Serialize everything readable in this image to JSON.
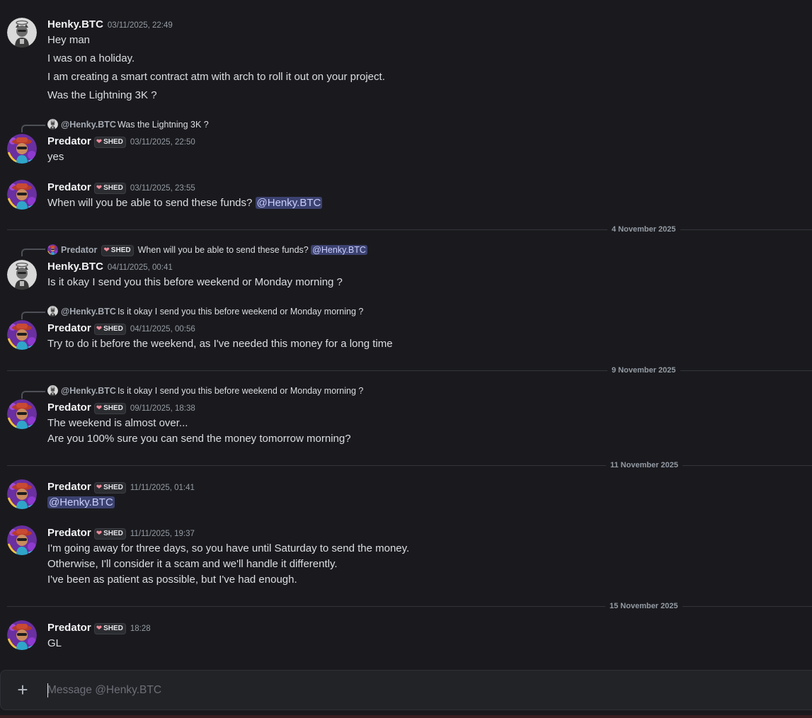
{
  "users": {
    "henky": {
      "name": "Henky.BTC"
    },
    "predator": {
      "name": "Predator",
      "tag": "SHED"
    }
  },
  "messages": [
    {
      "author": "Henky.BTC",
      "time": "03/11/2025, 22:49",
      "lines": [
        "Hey man",
        "I was on a holiday.",
        "I am creating a smart contract atm with arch to roll it out on your project.",
        "Was the Lightning 3K ?"
      ]
    },
    {
      "reply": {
        "who": "@Henky.BTC",
        "text": "Was the Lightning 3K ?"
      },
      "author": "Predator",
      "tag": "SHED",
      "time": "03/11/2025, 22:50",
      "lines": [
        "yes"
      ]
    },
    {
      "author": "Predator",
      "tag": "SHED",
      "time": "03/11/2025, 23:55",
      "text": "When will you be able to send these funds?",
      "mention": "@Henky.BTC"
    },
    {
      "reply": {
        "who": "Predator",
        "tag": "SHED",
        "text": "When will you be able to send these funds?",
        "mention": "@Henky.BTC"
      },
      "author": "Henky.BTC",
      "time": "04/11/2025, 00:41",
      "lines": [
        "Is it okay I send you this before weekend or Monday morning ?"
      ]
    },
    {
      "reply": {
        "who": "@Henky.BTC",
        "text": "Is it okay I send you this before weekend or Monday morning ?"
      },
      "author": "Predator",
      "tag": "SHED",
      "time": "04/11/2025, 00:56",
      "lines": [
        "Try to do it before the weekend, as I've needed this money for a long time"
      ]
    },
    {
      "reply": {
        "who": "@Henky.BTC",
        "text": "Is it okay I send you this before weekend or Monday morning ?"
      },
      "author": "Predator",
      "tag": "SHED",
      "time": "09/11/2025, 18:38",
      "lines": [
        "The weekend is almost over...",
        "Are you 100% sure you can send the money tomorrow morning?"
      ]
    },
    {
      "author": "Predator",
      "tag": "SHED",
      "time": "11/11/2025, 01:41",
      "mention": "@Henky.BTC"
    },
    {
      "author": "Predator",
      "tag": "SHED",
      "time": "11/11/2025, 19:37",
      "lines": [
        "I'm going away for three days, so you have until Saturday to send the money.",
        "Otherwise, I'll consider it a scam and we'll handle it differently.",
        "I've been as patient as possible, but I've had enough."
      ]
    },
    {
      "author": "Predator",
      "tag": "SHED",
      "time": "18:28",
      "lines": [
        "GL"
      ]
    }
  ],
  "dividers": [
    "4 November 2025",
    "9 November 2025",
    "11 November 2025",
    "15 November 2025"
  ],
  "composer": {
    "placeholder": "Message @Henky.BTC"
  },
  "colors": {
    "background": "#1a1a1e",
    "mention_bg": "#3c4270",
    "mention_text": "#c9cdfb",
    "tag_heart": "#f08a9a"
  }
}
